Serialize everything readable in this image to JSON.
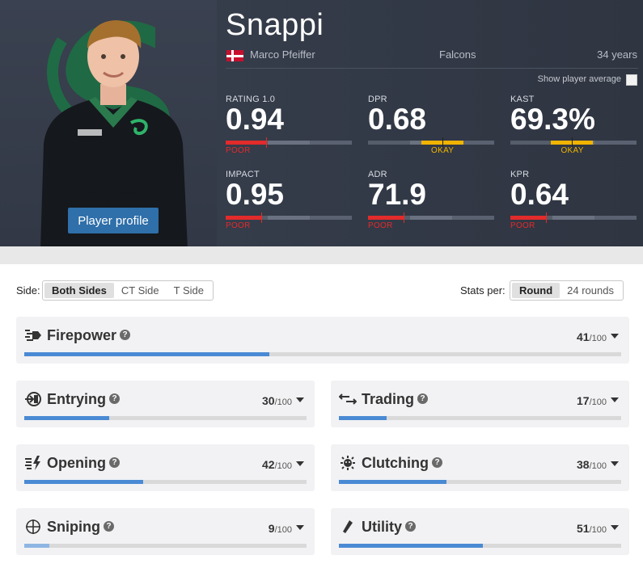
{
  "player": {
    "nickname": "Snappi",
    "real_name": "Marco Pfeiffer",
    "team": "Falcons",
    "age": "34 years",
    "country_flag": "denmark-flag",
    "profile_button": "Player profile",
    "show_average_label": "Show player average",
    "show_average_checked": false
  },
  "stats": [
    {
      "label": "RATING 1.0",
      "value": "0.94",
      "rating": "POOR",
      "level": 0.32
    },
    {
      "label": "DPR",
      "value": "0.68",
      "rating": "OKAY",
      "level": 0.59
    },
    {
      "label": "KAST",
      "value": "69.3%",
      "rating": "OKAY",
      "level": 0.49
    },
    {
      "label": "IMPACT",
      "value": "0.95",
      "rating": "POOR",
      "level": 0.28
    },
    {
      "label": "ADR",
      "value": "71.9",
      "rating": "POOR",
      "level": 0.28
    },
    {
      "label": "KPR",
      "value": "0.64",
      "rating": "POOR",
      "level": 0.28
    }
  ],
  "colors": {
    "poor": "#e22b2b",
    "okay": "#f0b400",
    "bar_fill": "#4a8ad4",
    "profile_button": "#2f6faa"
  },
  "controls": {
    "side_label": "Side:",
    "sides": [
      "Both Sides",
      "CT Side",
      "T Side"
    ],
    "selected_side": "Both Sides",
    "per_label": "Stats per:",
    "per_options": [
      "Round",
      "24 rounds"
    ],
    "selected_per": "Round"
  },
  "categories": [
    {
      "name": "Firepower",
      "score": "41",
      "out_of": "/100",
      "fraction": 0.41,
      "icon": "firepower-icon"
    },
    {
      "name": "Entrying",
      "score": "30",
      "out_of": "/100",
      "fraction": 0.3,
      "icon": "entrying-icon"
    },
    {
      "name": "Trading",
      "score": "17",
      "out_of": "/100",
      "fraction": 0.17,
      "icon": "trading-icon"
    },
    {
      "name": "Opening",
      "score": "42",
      "out_of": "/100",
      "fraction": 0.42,
      "icon": "opening-icon"
    },
    {
      "name": "Clutching",
      "score": "38",
      "out_of": "/100",
      "fraction": 0.38,
      "icon": "clutching-icon"
    },
    {
      "name": "Sniping",
      "score": "9",
      "out_of": "/100",
      "fraction": 0.09,
      "icon": "sniping-icon"
    },
    {
      "name": "Utility",
      "score": "51",
      "out_of": "/100",
      "fraction": 0.51,
      "icon": "utility-icon"
    }
  ]
}
